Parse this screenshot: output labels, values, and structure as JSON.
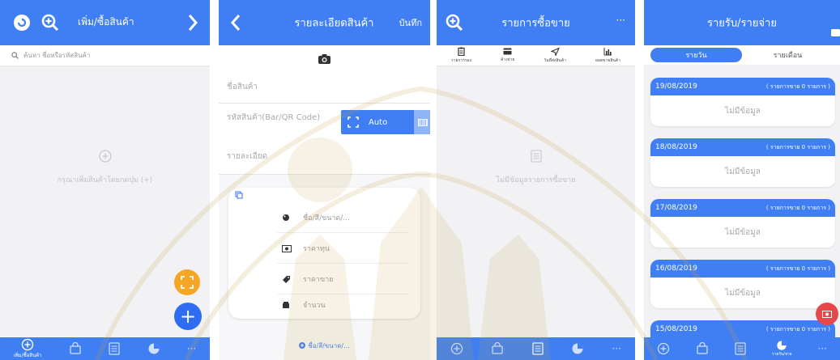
{
  "colors": {
    "primary": "#3f7ff3",
    "fab_orange": "#f6a623",
    "fab_blue": "#2e6df2",
    "fab_red": "#e8474a"
  },
  "p1": {
    "title": "เพิ่ม/ซื้อสินค้า",
    "search_placeholder": "ค้นหา ชื่อหรือรหัสสินค้า",
    "empty_text": "กรุณาเพิ่มสินค้าโดยกดปุ่ม (+)",
    "fab_add": "+",
    "tabs": [
      {
        "label": "เพิ่ม/ซื้อสินค้า",
        "icon": "add-circle-icon"
      },
      {
        "label": "",
        "icon": "bag-icon"
      },
      {
        "label": "",
        "icon": "list-icon"
      },
      {
        "label": "",
        "icon": "pie-chart-icon"
      },
      {
        "label": "",
        "icon": "more-icon"
      }
    ]
  },
  "p2": {
    "title": "รายละเอียดสินค้า",
    "save": "บันทึก",
    "name_label": "ชื่อสินค้า",
    "code_label": "รหัสสินค้า(Bar/QR Code)",
    "auto_label": "Auto",
    "detail_label": "รายละเอียด",
    "sub_rows": [
      {
        "label": "ชื่อ/สี/ขนาด/...",
        "icon": "palette-icon"
      },
      {
        "label": "ราคาทุน",
        "icon": "money-icon"
      },
      {
        "label": "ราคาขาย",
        "icon": "tag-icon"
      },
      {
        "label": "จำนวน",
        "icon": "box-icon"
      }
    ],
    "add_variant": "ชื่อ/สี/ขนาด/..."
  },
  "p3": {
    "title": "รายการซื้อขาย",
    "more": "···",
    "toolbar": [
      {
        "label": "รายการรอง",
        "icon": "clipboard-icon"
      },
      {
        "label": "ค้างจ่าย",
        "icon": "card-icon"
      },
      {
        "label": "วันที่ส่งสินค้า",
        "icon": "send-icon"
      },
      {
        "label": "ยอดขายสินค้า",
        "icon": "bar-chart-icon"
      }
    ],
    "empty_text": "ไม่มีข้อมูลรายการซื้อขาย"
  },
  "p4": {
    "title": "รายรับ/รายจ่าย",
    "seg": [
      "รายวัน",
      "รายเดือน"
    ],
    "cards": [
      {
        "date": "19/08/2019",
        "summary": "( รายการขาย 0 รายการ )",
        "body": "ไม่มีข้อมูล"
      },
      {
        "date": "18/08/2019",
        "summary": "( รายการขาย 0 รายการ )",
        "body": "ไม่มีข้อมูล"
      },
      {
        "date": "17/08/2019",
        "summary": "( รายการขาย 0 รายการ )",
        "body": "ไม่มีข้อมูล"
      },
      {
        "date": "16/08/2019",
        "summary": "( รายการขาย 0 รายการ )",
        "body": "ไม่มีข้อมูล"
      },
      {
        "date": "15/08/2019",
        "summary": "( รายการขาย 0 รายการ )",
        "body": ""
      }
    ],
    "tab_active_label": "รายรับ/จ่าย"
  }
}
